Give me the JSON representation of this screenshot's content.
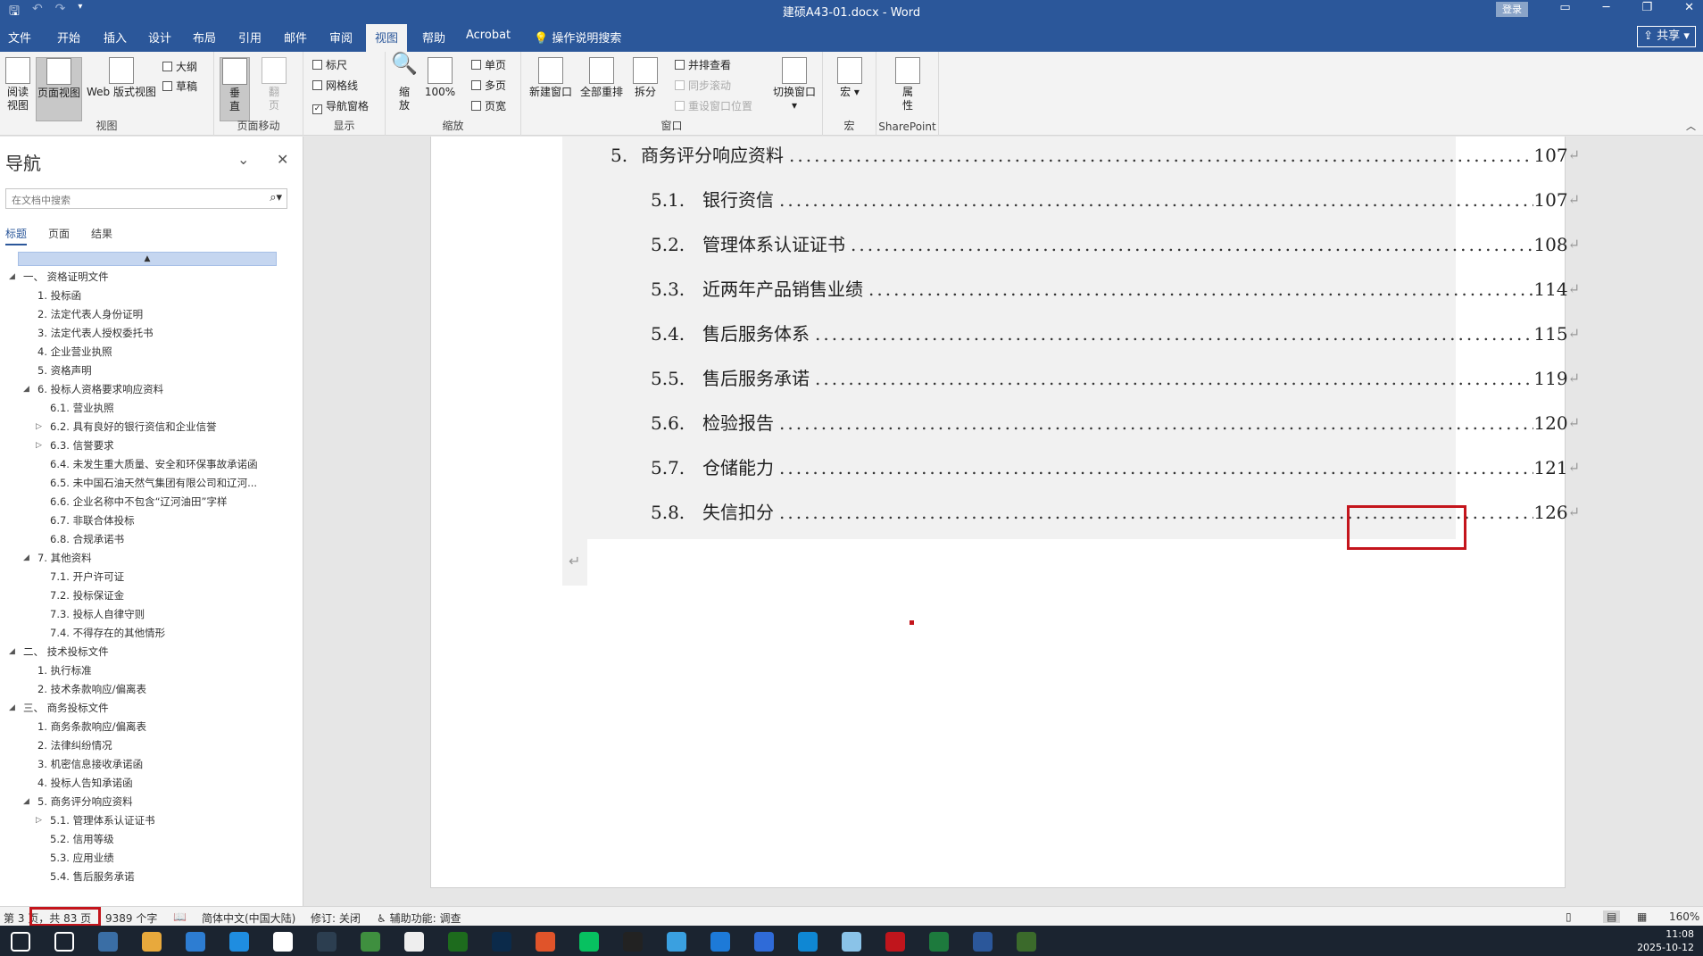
{
  "titlebar": {
    "qat": [
      "save-icon",
      "undo-icon",
      "redo-icon",
      "customize-icon"
    ],
    "title": "建硕A43-01.docx  -  Word",
    "login": "登录",
    "window_buttons": [
      "ribbon-display-icon",
      "minimize-icon",
      "restore-icon",
      "close-icon"
    ]
  },
  "tabs": [
    "文件",
    "开始",
    "插入",
    "设计",
    "布局",
    "引用",
    "邮件",
    "审阅",
    "视图",
    "帮助",
    "Acrobat",
    "操作说明搜索"
  ],
  "active_tab": "视图",
  "share": "共享",
  "ribbon": {
    "view_group": {
      "label": "视图",
      "read_mode": "阅读\n视图",
      "print_layout": "页面视图",
      "web_layout": "Web 版式视图",
      "outline": "大纲",
      "draft": "草稿"
    },
    "page_move_group": {
      "label": "页面移动",
      "vertical": "垂\n直",
      "side_by_side": "翻\n页"
    },
    "show_group": {
      "label": "显示",
      "ruler": "标尺",
      "gridlines": "网格线",
      "nav_pane": "导航窗格"
    },
    "zoom_group": {
      "label": "缩放",
      "zoom": "缩\n放",
      "pct100": "100%",
      "one_page": "单页",
      "multi_page": "多页",
      "page_width": "页宽"
    },
    "window_group": {
      "label": "窗口",
      "new_window": "新建窗口",
      "arrange_all": "全部重排",
      "split": "拆分",
      "side_by_side": "并排查看",
      "sync_scroll": "同步滚动",
      "reset_pos": "重设窗口位置",
      "switch": "切换窗口"
    },
    "macro_group": {
      "label": "宏",
      "macros": "宏"
    },
    "sharepoint_group": {
      "label": "SharePoint",
      "properties": "属\n性"
    }
  },
  "nav": {
    "title": "导航",
    "search_placeholder": "在文档中搜索",
    "tabs": [
      "标题",
      "页面",
      "结果"
    ],
    "active_tab": "标题",
    "items": [
      {
        "text": "一、 资格证明文件",
        "level": 0,
        "toggle": "expanded"
      },
      {
        "text": "1. 投标函",
        "level": 1,
        "toggle": "none"
      },
      {
        "text": "2. 法定代表人身份证明",
        "level": 1,
        "toggle": "none"
      },
      {
        "text": "3. 法定代表人授权委托书",
        "level": 1,
        "toggle": "none"
      },
      {
        "text": "4. 企业营业执照",
        "level": 1,
        "toggle": "none"
      },
      {
        "text": "5. 资格声明",
        "level": 1,
        "toggle": "none"
      },
      {
        "text": "6. 投标人资格要求响应资料",
        "level": 1,
        "toggle": "expanded"
      },
      {
        "text": "6.1. 营业执照",
        "level": 2,
        "toggle": "none"
      },
      {
        "text": "6.2. 具有良好的银行资信和企业信誉",
        "level": 2,
        "toggle": "collapsed"
      },
      {
        "text": "6.3. 信誉要求",
        "level": 2,
        "toggle": "collapsed"
      },
      {
        "text": "6.4. 未发生重大质量、安全和环保事故承诺函",
        "level": 2,
        "toggle": "none"
      },
      {
        "text": "6.5. 未中国石油天然气集团有限公司和辽河...",
        "level": 2,
        "toggle": "none"
      },
      {
        "text": "6.6. 企业名称中不包含“辽河油田”字样",
        "level": 2,
        "toggle": "none"
      },
      {
        "text": "6.7. 非联合体投标",
        "level": 2,
        "toggle": "none"
      },
      {
        "text": "6.8. 合规承诺书",
        "level": 2,
        "toggle": "none"
      },
      {
        "text": "7. 其他资料",
        "level": 1,
        "toggle": "expanded"
      },
      {
        "text": "7.1. 开户许可证",
        "level": 2,
        "toggle": "none"
      },
      {
        "text": "7.2. 投标保证金",
        "level": 2,
        "toggle": "none"
      },
      {
        "text": "7.3. 投标人自律守则",
        "level": 2,
        "toggle": "none"
      },
      {
        "text": "7.4. 不得存在的其他情形",
        "level": 2,
        "toggle": "none"
      },
      {
        "text": "二、 技术投标文件",
        "level": 0,
        "toggle": "expanded"
      },
      {
        "text": "1. 执行标准",
        "level": 1,
        "toggle": "none"
      },
      {
        "text": "2. 技术条款响应/偏离表",
        "level": 1,
        "toggle": "none"
      },
      {
        "text": "三、 商务投标文件",
        "level": 0,
        "toggle": "expanded"
      },
      {
        "text": "1. 商务条款响应/偏离表",
        "level": 1,
        "toggle": "none"
      },
      {
        "text": "2. 法律纠纷情况",
        "level": 1,
        "toggle": "none"
      },
      {
        "text": "3. 机密信息接收承诺函",
        "level": 1,
        "toggle": "none"
      },
      {
        "text": "4. 投标人告知承诺函",
        "level": 1,
        "toggle": "none"
      },
      {
        "text": "5. 商务评分响应资料",
        "level": 1,
        "toggle": "expanded"
      },
      {
        "text": "5.1. 管理体系认证证书",
        "level": 2,
        "toggle": "collapsed"
      },
      {
        "text": "5.2. 信用等级",
        "level": 2,
        "toggle": "none"
      },
      {
        "text": "5.3. 应用业绩",
        "level": 2,
        "toggle": "none"
      },
      {
        "text": "5.4. 售后服务承诺",
        "level": 2,
        "toggle": "none"
      }
    ]
  },
  "toc": [
    {
      "num": "5.",
      "title": "商务评分响应资料",
      "page": "107",
      "level": 1
    },
    {
      "num": "5.1.",
      "title": "银行资信",
      "page": "107",
      "level": 2
    },
    {
      "num": "5.2.",
      "title": "管理体系认证证书",
      "page": "108",
      "level": 2
    },
    {
      "num": "5.3.",
      "title": "近两年产品销售业绩",
      "page": "114",
      "level": 2
    },
    {
      "num": "5.4.",
      "title": "售后服务体系",
      "page": "115",
      "level": 2
    },
    {
      "num": "5.5.",
      "title": "售后服务承诺",
      "page": "119",
      "level": 2
    },
    {
      "num": "5.6.",
      "title": "检验报告",
      "page": "120",
      "level": 2
    },
    {
      "num": "5.7.",
      "title": "仓储能力",
      "page": "121",
      "level": 2
    },
    {
      "num": "5.8.",
      "title": "失信扣分",
      "page": "126",
      "level": 2
    }
  ],
  "paragraph_mark": "↵",
  "status": {
    "page": "第 3 页，共 83 页",
    "words": "9389 个字",
    "language": "简体中文(中国大陆)",
    "track": "修订: 关闭",
    "accessibility": "辅助功能: 调查",
    "zoom": "160%"
  },
  "taskbar": {
    "clock_time": "11:08",
    "clock_date": "2025-10-12",
    "apps": [
      "start-icon",
      "search-icon",
      "calculator-icon",
      "explorer-icon",
      "app-icon",
      "store-icon",
      "app-icon",
      "app-icon",
      "app-icon",
      "file-icon",
      "app-icon",
      "photoshop-icon",
      "app-icon",
      "wechat-icon",
      "qq-icon",
      "app-icon",
      "app-icon",
      "app-icon",
      "edge-icon",
      "app-icon",
      "acrobat-icon",
      "excel-icon",
      "word-icon",
      "app-icon"
    ]
  },
  "colors": {
    "accent": "#2b579a",
    "highlight_red": "#c4151c"
  }
}
